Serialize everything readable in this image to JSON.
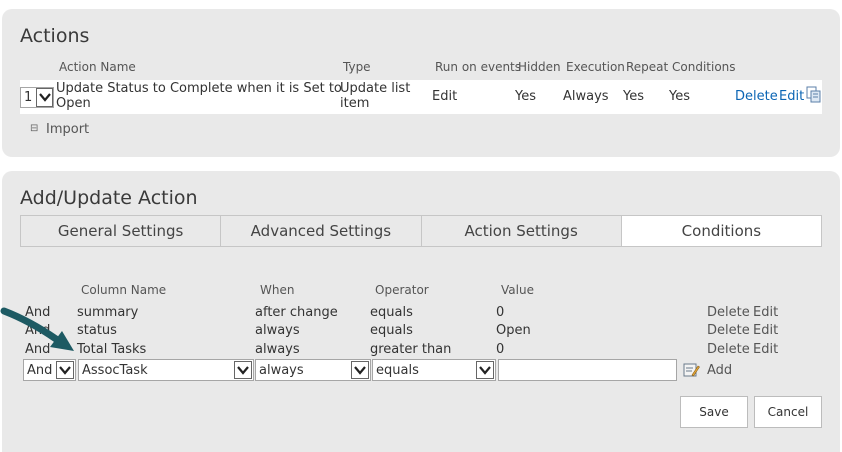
{
  "actions_panel": {
    "title": "Actions",
    "headers": {
      "action_name": "Action Name",
      "type": "Type",
      "run_on_events": "Run on events",
      "hidden": "Hidden",
      "execution": "Execution",
      "repeat": "Repeat",
      "conditions": "Conditions"
    },
    "row": {
      "order": "1",
      "name_line1": "Update Status to Complete when it is Set to",
      "name_line2": "Open",
      "type_line1": "Update list",
      "type_line2": "item",
      "run_on_events": "Edit",
      "hidden": "Yes",
      "execution": "Always",
      "repeat": "Yes",
      "conditions": "Yes",
      "delete": "Delete",
      "edit": "Edit"
    },
    "import_label": "Import",
    "import_toggle": "⊟"
  },
  "update_panel": {
    "title": "Add/Update Action",
    "tabs": [
      {
        "label": "General Settings"
      },
      {
        "label": "Advanced Settings"
      },
      {
        "label": "Action Settings"
      },
      {
        "label": "Conditions"
      }
    ],
    "active_tab": "Conditions",
    "headers": {
      "column_name": "Column Name",
      "when": "When",
      "operator": "Operator",
      "value": "Value"
    },
    "conditions": [
      {
        "join": "And",
        "column": "summary",
        "when": "after change",
        "operator": "equals",
        "value": "0",
        "delete": "Delete",
        "edit": "Edit"
      },
      {
        "join": "And",
        "column": "status",
        "when": "always",
        "operator": "equals",
        "value": "Open",
        "delete": "Delete",
        "edit": "Edit"
      },
      {
        "join": "And",
        "column": "Total Tasks",
        "when": "always",
        "operator": "greater than",
        "value": "0",
        "delete": "Delete",
        "edit": "Edit"
      }
    ],
    "new_condition": {
      "join": "And",
      "column": "AssocTask",
      "when": "always",
      "operator": "equals",
      "value": "",
      "add_label": "Add"
    },
    "save_label": "Save",
    "cancel_label": "Cancel"
  },
  "colors": {
    "panel_bg": "#e9e9e9",
    "link": "#0b65b4",
    "arrow": "#1d5a63"
  }
}
